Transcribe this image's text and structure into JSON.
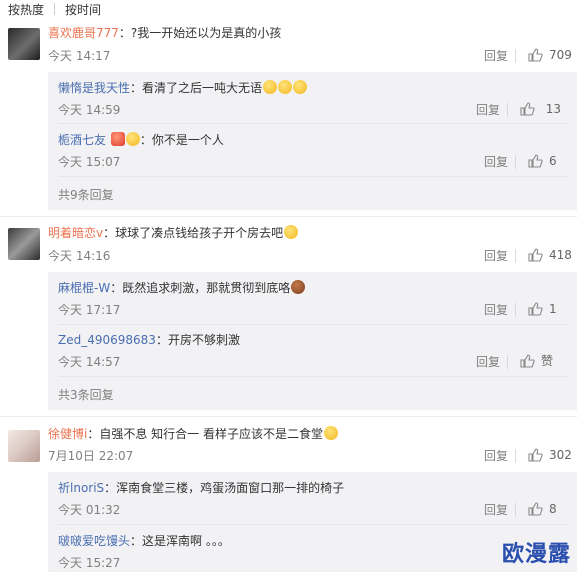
{
  "sort": {
    "hot": "按热度",
    "time": "按时间"
  },
  "reply_label": "回复",
  "comments": [
    {
      "user": "喜欢鹿哥777",
      "text": "：?我一开始还以为是真的小孩",
      "time": "今天 14:17",
      "likes": "709",
      "replies": [
        {
          "user": "懒惰是我天性",
          "text": "：看清了之后一吨大无语",
          "time": "今天 14:59",
          "likes": "13"
        },
        {
          "user": "栀酒七友",
          "text": "：你不是一个人",
          "time": "今天 15:07",
          "likes": "6"
        }
      ],
      "more": "共9条回复"
    },
    {
      "user": "明着暗恋v",
      "text": "：球球了凑点钱给孩子开个房去吧",
      "time": "今天 14:16",
      "likes": "418",
      "replies": [
        {
          "user": "麻棍棍-W",
          "text": "：既然追求刺激，那就贯彻到底咯",
          "time": "今天 17:17",
          "likes": "1"
        },
        {
          "user": "Zed_490698683",
          "text": "：开房不够刺激",
          "time": "今天 14:57",
          "likes": "赞"
        }
      ],
      "more": "共3条回复"
    },
    {
      "user": "徐健博i",
      "text": "：自强不息 知行合一 看样子应该不是二食堂",
      "time": "7月10日 22:07",
      "likes": "302",
      "replies": [
        {
          "user": "祈lnoriS",
          "text": "：浑南食堂三楼，鸡蛋汤面窗口那一排的椅子",
          "time": "今天 01:32",
          "likes": "8"
        },
        {
          "user": "啵啵爱吃馒头",
          "text": "：这是浑南啊 。。。",
          "time": "今天 15:27",
          "likes": ""
        }
      ]
    }
  ],
  "watermark": "欧漫露",
  "icons": {
    "like": "thumbs-up-icon",
    "rank": "v-badge-icon",
    "emoji": "emoji-icon"
  },
  "colors": {
    "name": "#eb7350",
    "sub_name": "#4a6eb0",
    "meta": "#808080",
    "sub_bg": "#f2f2f5",
    "watermark": "#2a4fae"
  }
}
